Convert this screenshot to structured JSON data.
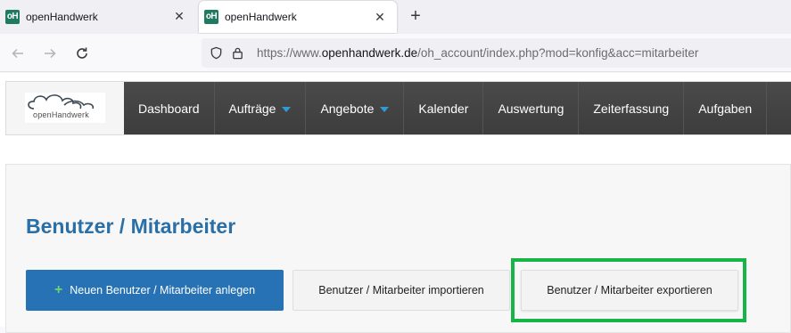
{
  "browser": {
    "tabs": [
      {
        "favicon": "oH",
        "title": "openHandwerk",
        "close": "✕"
      },
      {
        "favicon": "oH",
        "title": "openHandwerk",
        "close": "✕"
      }
    ],
    "new_tab": "+",
    "url_prefix": "https://www.",
    "url_domain": "openhandwerk.de",
    "url_path": "/oh_account/index.php?mod=konfig&acc=mitarbeiter"
  },
  "logo": {
    "text": "openHandwerk"
  },
  "menu": [
    {
      "label": "Dashboard",
      "dropdown": false
    },
    {
      "label": "Aufträge",
      "dropdown": true
    },
    {
      "label": "Angebote",
      "dropdown": true
    },
    {
      "label": "Kalender",
      "dropdown": false
    },
    {
      "label": "Auswertung",
      "dropdown": false
    },
    {
      "label": "Zeiterfassung",
      "dropdown": false
    },
    {
      "label": "Aufgaben",
      "dropdown": false
    }
  ],
  "main": {
    "title": "Benutzer / Mitarbeiter",
    "buttons": {
      "create_icon": "+",
      "create": "Neuen Benutzer / Mitarbeiter anlegen",
      "import": "Benutzer / Mitarbeiter importieren",
      "export": "Benutzer / Mitarbeiter exportieren"
    }
  },
  "colors": {
    "accent": "#2672b4",
    "title": "#2a6fa5",
    "highlight": "#17b548",
    "menu_bg": "#434343",
    "caret": "#2e9bd6"
  }
}
